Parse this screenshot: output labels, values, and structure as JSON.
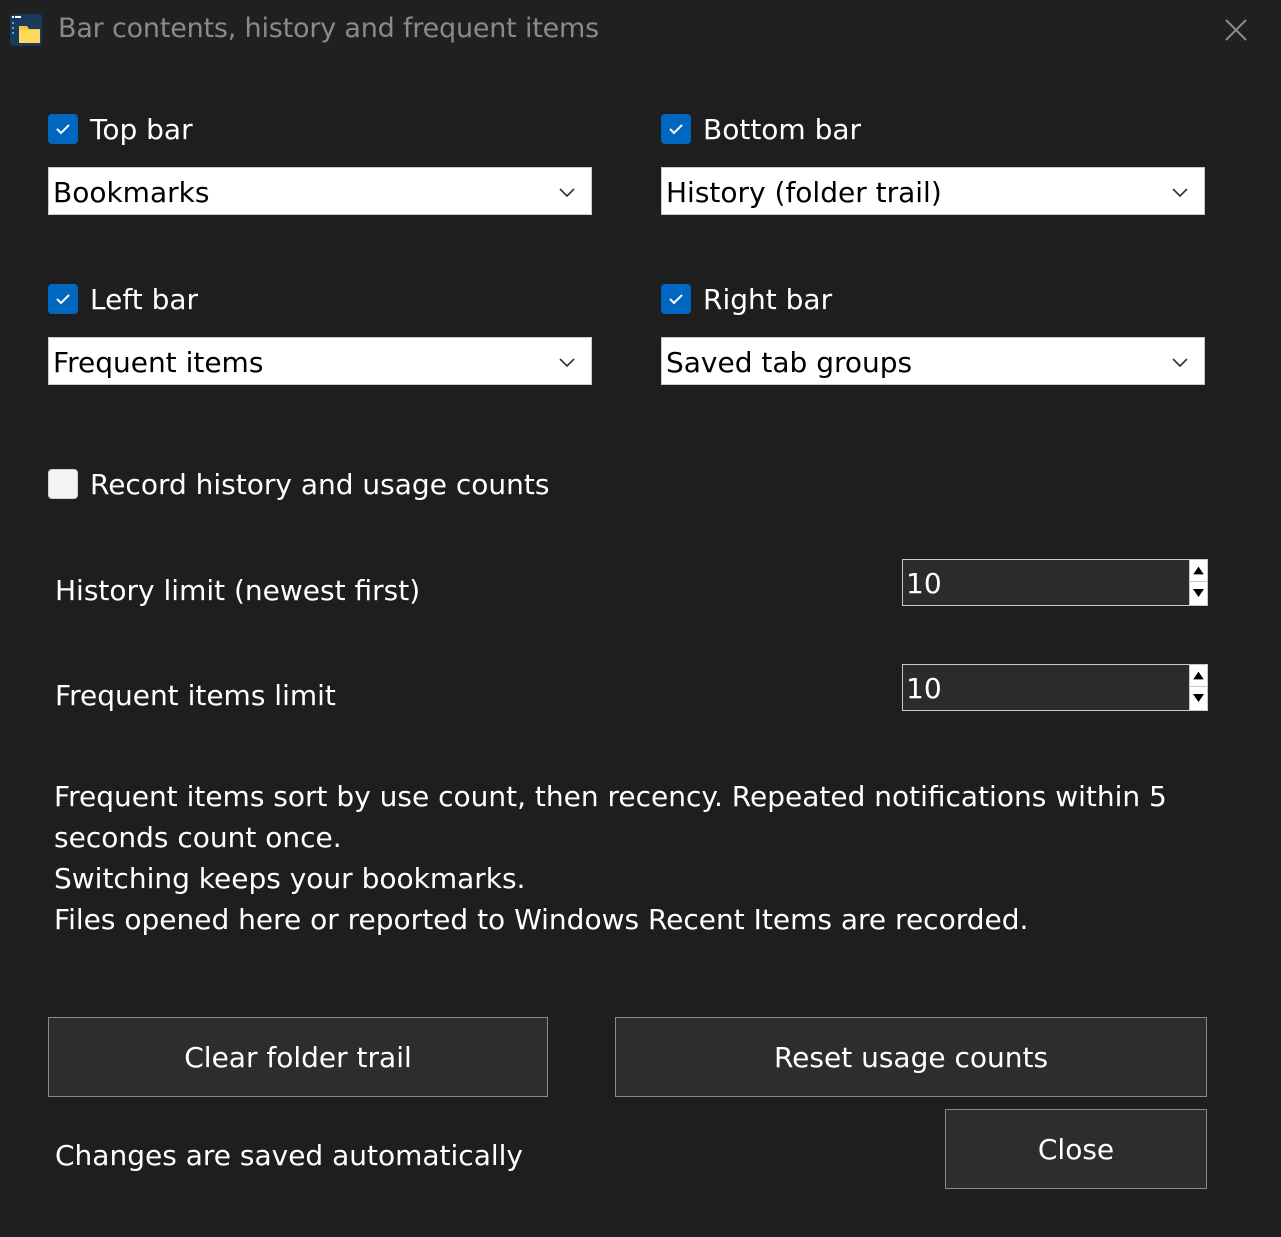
{
  "window": {
    "title": "Bar contents, history and frequent items",
    "app_icon": "folder-app-icon",
    "close_icon": "close-icon"
  },
  "bars": {
    "top": {
      "label": "Top bar",
      "checked": true,
      "selected": "Bookmarks"
    },
    "bottom": {
      "label": "Bottom bar",
      "checked": true,
      "selected": "History (folder trail)"
    },
    "left": {
      "label": "Left bar",
      "checked": true,
      "selected": "Frequent items"
    },
    "right": {
      "label": "Right bar",
      "checked": true,
      "selected": "Saved tab groups"
    }
  },
  "record": {
    "label": "Record history and usage counts",
    "checked": false
  },
  "limits": {
    "history_label": "History limit (newest first)",
    "history_value": "10",
    "frequent_label": "Frequent items limit",
    "frequent_value": "10"
  },
  "info": {
    "line1": "Frequent items sort by use count, then recency. Repeated notifications within 5",
    "line2": "seconds count once.",
    "line3": "Switching keeps your bookmarks.",
    "line4": "Files opened here or reported to Windows Recent Items are recorded."
  },
  "buttons": {
    "clear_trail": "Clear folder trail",
    "reset_counts": "Reset usage counts",
    "close": "Close"
  },
  "status": "Changes are saved automatically",
  "colors": {
    "accent": "#0067c0",
    "background": "#1e1e1e",
    "button": "#2d2d2d"
  }
}
